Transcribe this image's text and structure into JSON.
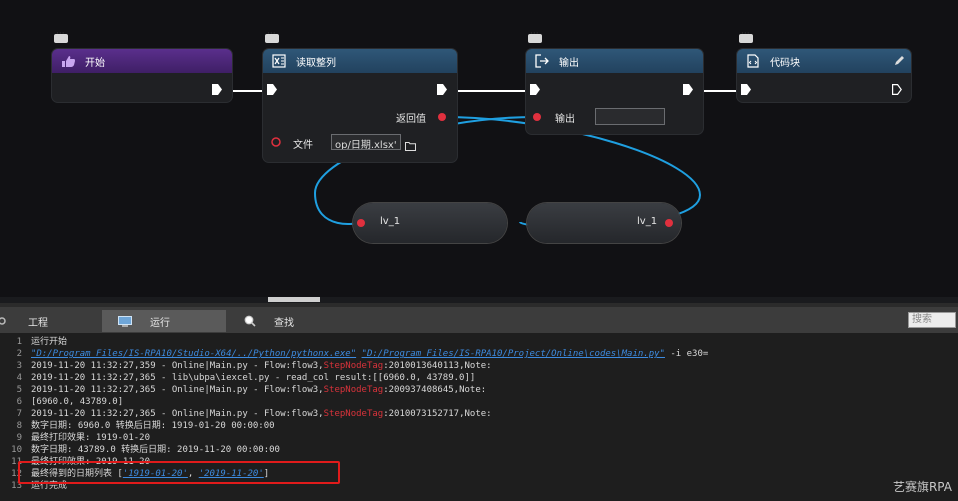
{
  "nodes": {
    "start": {
      "title": "开始"
    },
    "read": {
      "title": "读取整列",
      "return_label": "返回值",
      "file_label": "文件",
      "file_value": "op/日期.xlsx'"
    },
    "output": {
      "title": "输出",
      "output_label": "输出",
      "output_value": ""
    },
    "code": {
      "title": "代码块"
    },
    "var_left": {
      "label": "lv_1"
    },
    "var_right": {
      "label": "lv_1"
    }
  },
  "tabs": [
    {
      "label": "工程"
    },
    {
      "label": "运行"
    },
    {
      "label": "查找"
    }
  ],
  "search": {
    "placeholder": "搜索"
  },
  "log": {
    "lines": [
      {
        "n": "1",
        "parts": [
          {
            "t": "运行开始",
            "c": "txt"
          }
        ]
      },
      {
        "n": "2",
        "parts": [
          {
            "t": "\"D:/Program Files/IS-RPA10/Studio-X64/../Python/pythonx.exe\"",
            "c": "link"
          },
          {
            "t": "  ",
            "c": "txt"
          },
          {
            "t": "\"D:/Program Files/IS-RPA10/Project/Online\\codes\\Main.py\"",
            "c": "link"
          },
          {
            "t": " -i e30=",
            "c": "txt"
          }
        ]
      },
      {
        "n": "3",
        "parts": [
          {
            "t": "2019-11-20 11:32:27,359 - Online|Main.py - Flow:flow3,",
            "c": "txt"
          },
          {
            "t": "StepNodeTag",
            "c": "red"
          },
          {
            "t": ":2010013640113,Note:",
            "c": "txt"
          }
        ]
      },
      {
        "n": "4",
        "parts": [
          {
            "t": "2019-11-20 11:32:27,365 - lib\\ubpa\\iexcel.py - read_col result:[[6960.0, 43789.0]]",
            "c": "txt"
          }
        ]
      },
      {
        "n": "5",
        "parts": [
          {
            "t": "2019-11-20 11:32:27,365 - Online|Main.py - Flow:flow3,",
            "c": "txt"
          },
          {
            "t": "StepNodeTag",
            "c": "red"
          },
          {
            "t": ":200937408645,Note:",
            "c": "txt"
          }
        ]
      },
      {
        "n": "6",
        "parts": [
          {
            "t": "[6960.0, 43789.0]",
            "c": "txt"
          }
        ]
      },
      {
        "n": "7",
        "parts": [
          {
            "t": "2019-11-20 11:32:27,365 - Online|Main.py - Flow:flow3,",
            "c": "txt"
          },
          {
            "t": "StepNodeTag",
            "c": "red"
          },
          {
            "t": ":2010073152717,Note:",
            "c": "txt"
          }
        ]
      },
      {
        "n": "8",
        "parts": [
          {
            "t": "数字日期: 6960.0  转换后日期:  1919-01-20 00:00:00",
            "c": "txt"
          }
        ]
      },
      {
        "n": "9",
        "parts": [
          {
            "t": "最终打印效果: 1919-01-20",
            "c": "txt"
          }
        ]
      },
      {
        "n": "10",
        "parts": [
          {
            "t": "数字日期: 43789.0  转换后日期:  2019-11-20 00:00:00",
            "c": "txt"
          }
        ]
      },
      {
        "n": "11",
        "parts": [
          {
            "t": "最终打印效果: 2019-11-20",
            "c": "txt"
          }
        ]
      },
      {
        "n": "12",
        "parts": [
          {
            "t": "最终得到的日期列表 [",
            "c": "txt"
          },
          {
            "t": "'1919-01-20'",
            "c": "link"
          },
          {
            "t": ", ",
            "c": "txt"
          },
          {
            "t": "'2019-11-20'",
            "c": "link"
          },
          {
            "t": "]",
            "c": "txt"
          }
        ]
      },
      {
        "n": "13",
        "parts": [
          {
            "t": "运行完成",
            "c": "txt"
          }
        ]
      }
    ]
  },
  "watermark": "艺赛旗RPA",
  "colors": {
    "accent_red": "#e0303e",
    "wire": "#1f9fe0",
    "head_purple": "#4a2678",
    "head_blue": "#2a4c6a"
  }
}
